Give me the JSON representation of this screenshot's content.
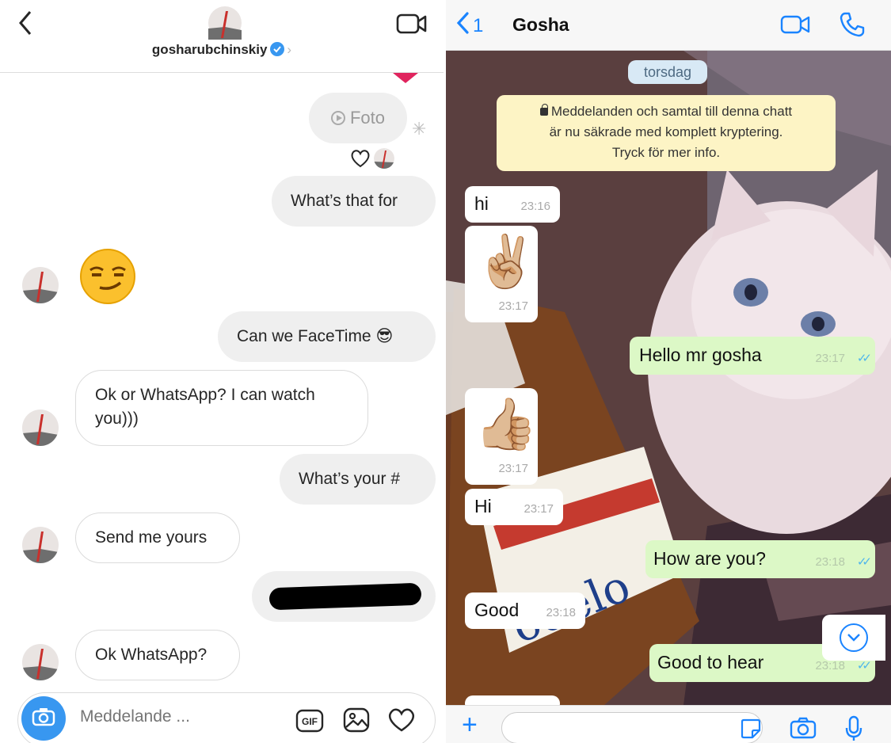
{
  "instagram": {
    "header": {
      "username": "gosharubchinskiy",
      "chevron": "›"
    },
    "messages": {
      "foto_label": "Foto",
      "m1": "What’s that for",
      "m2": "Can we FaceTime 😎",
      "m3": "Ok or WhatsApp? I can watch you)))",
      "m4": "What’s your #",
      "m5": "Send me yours",
      "m6": "Ok WhatsApp?"
    },
    "composer": {
      "placeholder": "Meddelande ..."
    },
    "icons": [
      "back-arrow-icon",
      "video-call-icon",
      "verified-badge-icon",
      "heart-icon",
      "camera-icon",
      "gif-icon",
      "gallery-icon"
    ],
    "colors": {
      "accent": "#3897f0",
      "bubble_out": "#efefef"
    }
  },
  "whatsapp": {
    "header": {
      "back_count": "1",
      "title": "Gosha"
    },
    "day_label": "torsdag",
    "encryption_notice": {
      "line1": "Meddelanden och samtal till denna chatt",
      "line2": "är nu säkrade med komplett kryptering.",
      "line3": "Tryck för mer info."
    },
    "messages": [
      {
        "text": "hi",
        "time": "23:16",
        "dir": "in"
      },
      {
        "text": "✌🏼",
        "time": "23:17",
        "dir": "in"
      },
      {
        "text": "Hello mr gosha",
        "time": "23:17",
        "dir": "out"
      },
      {
        "text": "👍🏼",
        "time": "23:17",
        "dir": "in"
      },
      {
        "text": "Hi",
        "time": "23:17",
        "dir": "in"
      },
      {
        "text": "How are you?",
        "time": "23:18",
        "dir": "out"
      },
      {
        "text": "Good",
        "time": "23:18",
        "dir": "in"
      },
      {
        "text": "Good to hear",
        "time": "23:18",
        "dir": "out"
      }
    ],
    "ticks": "✓✓",
    "colors": {
      "accent": "#1a84ff",
      "bubble_out": "#dcf8c6",
      "encryption_bg": "#fdf4c5"
    }
  }
}
